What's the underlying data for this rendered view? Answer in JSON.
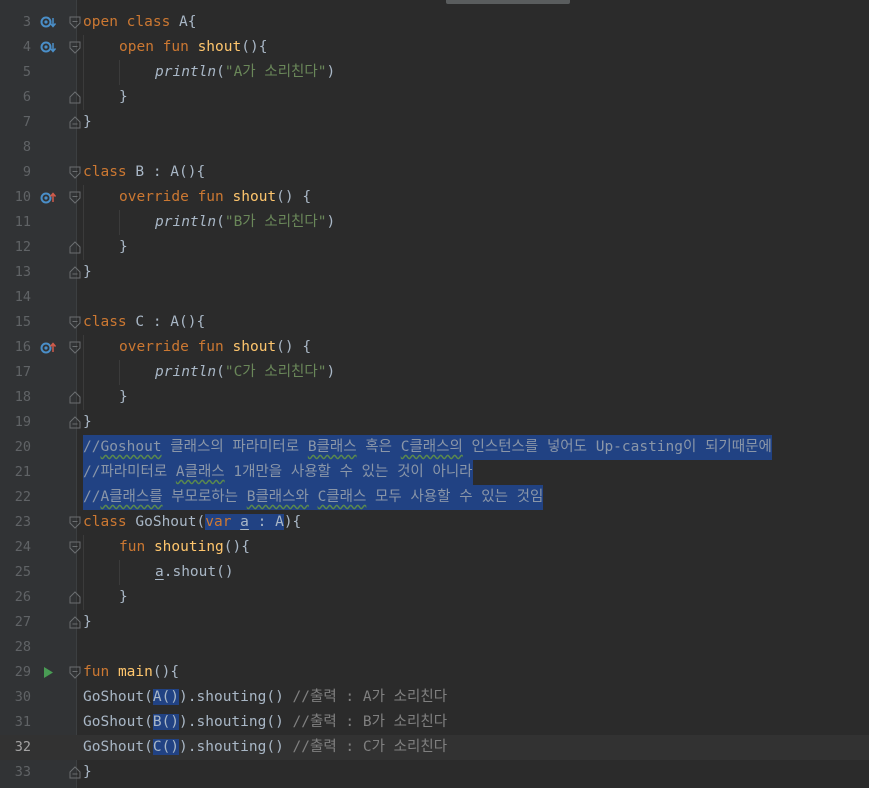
{
  "editor": {
    "current_line": "32",
    "lines": [
      {
        "num": "3",
        "parts": {
          "kw1": "open class",
          "cls": " A{"
        }
      },
      {
        "num": "4",
        "parts": {
          "kw1": "open fun",
          "fn": "shout",
          "rest": "(){"
        }
      },
      {
        "num": "5",
        "parts": {
          "fn": "println",
          "rest1": "(",
          "str": "\"A가 소리친다\"",
          "rest2": ")"
        }
      },
      {
        "num": "6",
        "parts": {
          "rest": "}"
        }
      },
      {
        "num": "7",
        "parts": {
          "rest": "}"
        }
      },
      {
        "num": "8",
        "parts": {}
      },
      {
        "num": "9",
        "parts": {
          "kw1": "class",
          "cls": " B : A(){"
        }
      },
      {
        "num": "10",
        "parts": {
          "kw1": "override fun",
          "fn": "shout",
          "rest": "() {"
        }
      },
      {
        "num": "11",
        "parts": {
          "fn": "println",
          "rest1": "(",
          "str": "\"B가 소리친다\"",
          "rest2": ")"
        }
      },
      {
        "num": "12",
        "parts": {
          "rest": "}"
        }
      },
      {
        "num": "13",
        "parts": {
          "rest": "}"
        }
      },
      {
        "num": "14",
        "parts": {}
      },
      {
        "num": "15",
        "parts": {
          "kw1": "class",
          "cls": " C : A(){"
        }
      },
      {
        "num": "16",
        "parts": {
          "kw1": "override fun",
          "fn": "shout",
          "rest": "() {"
        }
      },
      {
        "num": "17",
        "parts": {
          "fn": "println",
          "rest1": "(",
          "str": "\"C가 소리친다\"",
          "rest2": ")"
        }
      },
      {
        "num": "18",
        "parts": {
          "rest": "}"
        }
      },
      {
        "num": "19",
        "parts": {
          "rest": "}"
        }
      },
      {
        "num": "20",
        "parts": {
          "c1": "//",
          "c2": "Goshout",
          "c3": " 클래스의 파라미터로 ",
          "c4": "B클래스",
          "c5": " 혹은 ",
          "c6": "C클래스의",
          "c7": " 인스턴스를 넣어도 Up-casting이 되기때문에"
        }
      },
      {
        "num": "21",
        "parts": {
          "c1": "//파라미터로 ",
          "c2": "A클래스",
          "c3": " 1개만을 사용할 수 있는 것이 아니라"
        }
      },
      {
        "num": "22",
        "parts": {
          "c1": "//",
          "c2": "A클래스를",
          "c3": " 부모로하는 ",
          "c4": "B클래스와",
          "c5": " ",
          "c6": "C클래스",
          "c7": " 모두 사용할 수 있는 것임"
        }
      },
      {
        "num": "23",
        "parts": {
          "kw1": "class",
          "cls": " GoShout(",
          "kw2": "var",
          "sp": " ",
          "param": "a",
          "rest": " : A",
          "rest2": "){"
        }
      },
      {
        "num": "24",
        "parts": {
          "kw1": "fun",
          "fn": "shouting",
          "rest": "(){"
        }
      },
      {
        "num": "25",
        "parts": {
          "param": "a",
          "rest": ".shout()"
        }
      },
      {
        "num": "26",
        "parts": {
          "rest": "}"
        }
      },
      {
        "num": "27",
        "parts": {
          "rest": "}"
        }
      },
      {
        "num": "28",
        "parts": {}
      },
      {
        "num": "29",
        "parts": {
          "kw1": "fun",
          "fn": "main",
          "rest": "(){"
        }
      },
      {
        "num": "30",
        "parts": {
          "a": "GoShout(",
          "b": "A()",
          "c": ").shouting() ",
          "cmt": "//출력 : A가 소리친다"
        }
      },
      {
        "num": "31",
        "parts": {
          "a": "GoShout(",
          "b": "B()",
          "c": ").shouting() ",
          "cmt": "//출력 : B가 소리친다"
        }
      },
      {
        "num": "32",
        "parts": {
          "a": "GoShout(",
          "b": "C()",
          "c": ").shouting() ",
          "cmt": "//출력 : C가 소리친다"
        }
      },
      {
        "num": "33",
        "parts": {
          "rest": "}"
        }
      }
    ]
  },
  "colors": {
    "background": "#2b2b2b",
    "keyword": "#cc7832",
    "function": "#ffc66d",
    "string": "#6a8759",
    "comment": "#808080",
    "selection": "#214283",
    "gutter_icon": "#4a8fc9",
    "run_icon": "#499c54"
  },
  "gutter_icons": {
    "3": "overridden-method-icon",
    "4": "overridden-method-icon",
    "10": "overriding-method-icon",
    "16": "overriding-method-icon",
    "29": "run-icon"
  }
}
